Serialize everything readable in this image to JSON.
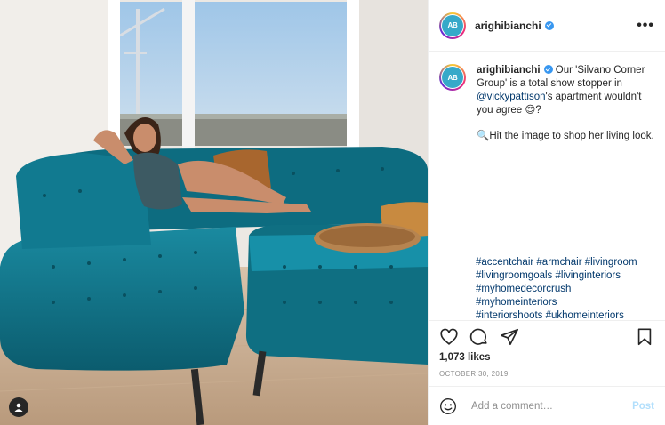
{
  "post": {
    "username": "arighibianchi",
    "avatar_initials": "AB",
    "more_glyph": "•••"
  },
  "caption": {
    "username": "arighibianchi",
    "text_before_mention": "Our 'Silvano Corner Group' is a total show stopper in ",
    "mention": "@vickypattison",
    "text_after_mention": "'s apartment wouldn't you agree 😍?",
    "second_paragraph": "🔍Hit the image to shop her living look.",
    "hashtag_lines": [
      "#accentchair #armchair #livingroom",
      "#livingroomgoals #livinginteriors",
      "#myhomedecorcrush",
      "#myhomeinteriors",
      "#interiorshoots #ukhomeinteriors"
    ]
  },
  "stats": {
    "likes": "1,073 likes",
    "date": "OCTOBER 30, 2019"
  },
  "comment_box": {
    "placeholder": "Add a comment…",
    "post_label": "Post"
  },
  "colors": {
    "sofa": "#0f6f82",
    "verified": "#3897f0",
    "link": "#00376b",
    "post_disabled": "#b2dffc",
    "brand": "#36a9c9"
  },
  "icons": [
    "heart-icon",
    "comment-icon",
    "share-icon",
    "bookmark-icon",
    "emoji-icon",
    "more-options-icon",
    "verified-badge-icon",
    "user-tag-icon"
  ]
}
